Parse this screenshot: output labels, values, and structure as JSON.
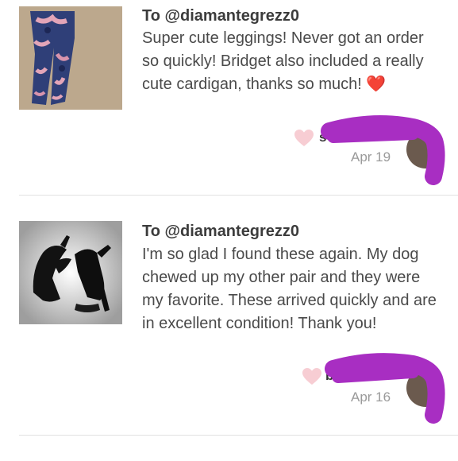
{
  "reviews": [
    {
      "to": "To @diamantegrezz0",
      "text": "Super cute leggings! Never got an order so quickly! Bridget also included a really cute cardigan, thanks so much! ❤️",
      "user": "s",
      "date": "Apr 19",
      "image": "leggings-photo"
    },
    {
      "to": "To @diamantegrezz0",
      "text": "I'm so glad I found these again. My dog chewed up my other pair and they were my favorite. These arrived quickly and are in excellent condition! Thank you!",
      "user": "bb",
      "date": "Apr 16",
      "image": "heels-photo"
    }
  ],
  "colors": {
    "heart": "#f7cdd3",
    "redaction": "#a82ec2",
    "divider": "#e2e2e2"
  }
}
